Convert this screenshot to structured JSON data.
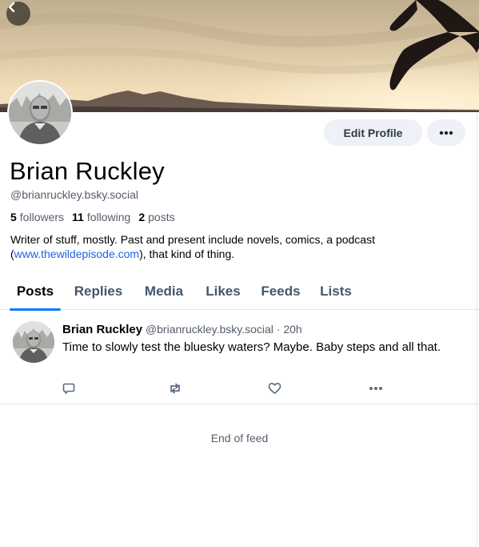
{
  "profile": {
    "display_name": "Brian Ruckley",
    "handle": "@brianruckley.bsky.social",
    "followers_count": "5",
    "followers_label": "followers",
    "following_count": "11",
    "following_label": "following",
    "posts_count": "2",
    "posts_label": "posts",
    "bio_before": "Writer of stuff, mostly. Past and present include novels, comics, a podcast (",
    "bio_link": "www.thewildepisode.com",
    "bio_after": "), that kind of thing."
  },
  "actions": {
    "edit_profile_label": "Edit Profile",
    "more_icon": "ellipsis-icon",
    "back_icon": "chevron-left-icon"
  },
  "tabs": [
    {
      "label": "Posts",
      "active": true
    },
    {
      "label": "Replies",
      "active": false
    },
    {
      "label": "Media",
      "active": false
    },
    {
      "label": "Likes",
      "active": false
    },
    {
      "label": "Feeds",
      "active": false
    },
    {
      "label": "Lists",
      "active": false
    }
  ],
  "feed": {
    "posts": [
      {
        "author_name": "Brian Ruckley",
        "author_handle": "@brianruckley.bsky.social",
        "separator": "·",
        "time": "20h",
        "text": "Time to slowly test the bluesky waters? Maybe. Baby steps and all that.",
        "actions": [
          "reply-icon",
          "repost-icon",
          "like-icon",
          "more-options-icon"
        ]
      }
    ],
    "end_text": "End of feed"
  },
  "colors": {
    "accent": "#0a7aff",
    "link": "#1d64e6",
    "muted_text": "#545d6b",
    "button_bg": "#eef1f5"
  }
}
